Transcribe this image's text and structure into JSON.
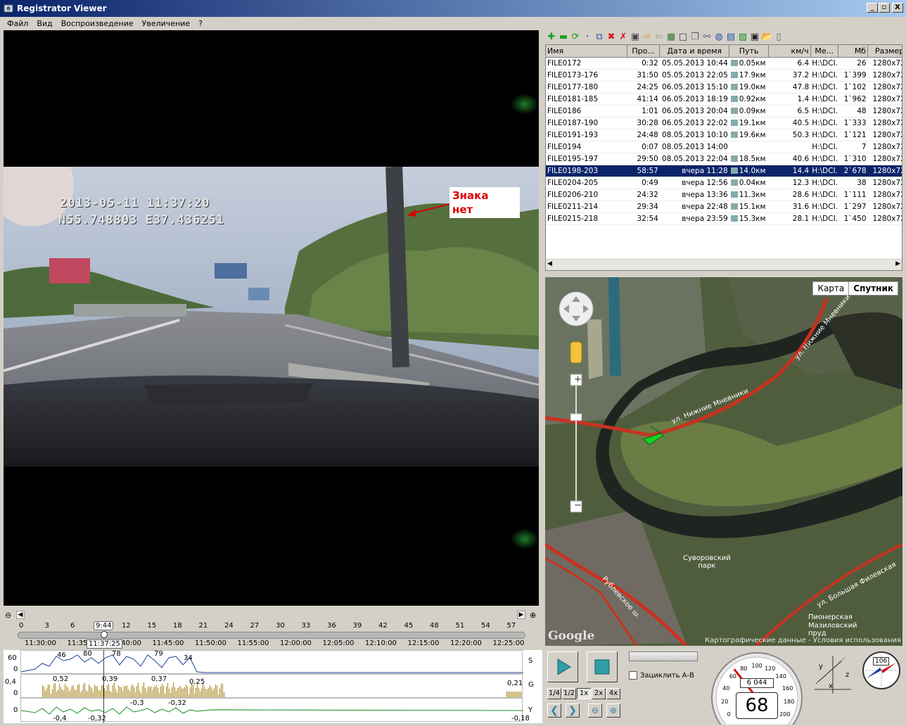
{
  "window": {
    "title": "Registrator Viewer",
    "minimize": "_",
    "restore": "▫",
    "close": "X"
  },
  "menu": [
    "Файл",
    "Вид",
    "Воспроизведение",
    "Увеличение",
    "?"
  ],
  "video": {
    "osd_datetime": "2013-05-11 11:37:20",
    "osd_coords": "N55.748803 E37.436251",
    "annotation": "Знака\nнет"
  },
  "filelist": {
    "columns": [
      "Имя",
      "Про...",
      "Дата и время",
      "Путь",
      "км/ч",
      "Ме...",
      "Мб",
      "Размер"
    ],
    "rows": [
      [
        "FILE0172",
        "0:32",
        "05.05.2013 10:44",
        "0.05км",
        "6.4",
        "H:\\DCI...",
        "26",
        "1280x720"
      ],
      [
        "FILE0173-176",
        "31:50",
        "05.05.2013 22:05",
        "17.9км",
        "37.2",
        "H:\\DCI...",
        "1`399",
        "1280x720"
      ],
      [
        "FILE0177-180",
        "24:25",
        "06.05.2013 15:10",
        "19.0км",
        "47.8",
        "H:\\DCI...",
        "1`102",
        "1280x720"
      ],
      [
        "FILE0181-185",
        "41:14",
        "06.05.2013 18:19",
        "0.92км",
        "1.4",
        "H:\\DCI...",
        "1`962",
        "1280x720"
      ],
      [
        "FILE0186",
        "1:01",
        "06.05.2013 20:04",
        "0.09км",
        "6.5",
        "H:\\DCI...",
        "48",
        "1280x720"
      ],
      [
        "FILE0187-190",
        "30:28",
        "06.05.2013 22:02",
        "19.1км",
        "40.5",
        "H:\\DCI...",
        "1`333",
        "1280x720"
      ],
      [
        "FILE0191-193",
        "24:48",
        "08.05.2013 10:10",
        "19.6км",
        "50.3",
        "H:\\DCI...",
        "1`121",
        "1280x720"
      ],
      [
        "FILE0194",
        "0:07",
        "08.05.2013 14:00",
        "",
        "",
        "H:\\DCI...",
        "7",
        "1280x720"
      ],
      [
        "FILE0195-197",
        "29:50",
        "08.05.2013 22:04",
        "18.5км",
        "40.6",
        "H:\\DCI...",
        "1`310",
        "1280x720"
      ],
      [
        "FILE0198-203",
        "58:57",
        "вчера 11:28",
        "14.0км",
        "14.4",
        "H:\\DCI...",
        "2`678",
        "1280x720"
      ],
      [
        "FILE0204-205",
        "0:49",
        "вчера 12:56",
        "0.04км",
        "12.3",
        "H:\\DCI...",
        "38",
        "1280x720"
      ],
      [
        "FILE0206-210",
        "24:32",
        "вчера 13:36",
        "11.3км",
        "28.6",
        "H:\\DCI...",
        "1`111",
        "1280x720"
      ],
      [
        "FILE0211-214",
        "29:34",
        "вчера 22:48",
        "15.1км",
        "31.6",
        "H:\\DCI...",
        "1`297",
        "1280x720"
      ],
      [
        "FILE0215-218",
        "32:54",
        "вчера 23:59",
        "15.3км",
        "28.1",
        "H:\\DCI...",
        "1`450",
        "1280x720"
      ]
    ],
    "selected_index": 9
  },
  "map": {
    "type_map": "Карта",
    "type_satellite": "Спутник",
    "active_type": "Спутник",
    "street1": "ул. Нижние Мневники",
    "street2": "ул. Нижние Мневники",
    "park": "Суворовский\nпарк",
    "station": "Пионерская",
    "pond": "Мазиловский\nпруд",
    "street3": "ул. Большая Филевская",
    "street4": "Рублевское ш.",
    "google": "Google",
    "credit": "Картографические данные - Условия использования"
  },
  "timeline": {
    "minutes": [
      "0",
      "3",
      "6",
      "9",
      "12",
      "15",
      "18",
      "21",
      "24",
      "27",
      "30",
      "33",
      "36",
      "39",
      "42",
      "45",
      "48",
      "51",
      "54",
      "57"
    ],
    "position_label": "9:44",
    "clock_ticks": [
      "11:30:00",
      "11:35",
      "11:40:00",
      "11:45:00",
      "11:50:00",
      "11:55:00",
      "12:00:00",
      "12:05:00",
      "12:10:00",
      "12:15:00",
      "12:20:00",
      "12:25:00"
    ],
    "clock_position": "11:37:25"
  },
  "graphs": {
    "speed": {
      "axis": "S",
      "ymax": "60",
      "ymin": "0",
      "labels": [
        "46",
        "80",
        "78",
        "79",
        "34"
      ]
    },
    "g": {
      "axis": "G",
      "ymax": "0,4",
      "ymin": "0",
      "labels": [
        "0,52",
        "0,39",
        "0,37",
        "0,25",
        "0,21"
      ]
    },
    "y": {
      "axis": "Y",
      "ymin": "0",
      "labels": [
        "-0,3",
        "-0,32",
        "-0,4",
        "-0,32",
        "-0,18"
      ]
    }
  },
  "controls": {
    "loop_label": "Зациклить А-В",
    "speeds": [
      "1/4",
      "1/2",
      "1x",
      "2x",
      "4x"
    ],
    "active_speed": "1x"
  },
  "speedometer": {
    "ticks": [
      "0",
      "20",
      "40",
      "60",
      "80",
      "100",
      "120",
      "140",
      "160",
      "180",
      "200"
    ],
    "odometer": "6 044",
    "speed": "68"
  },
  "compass": {
    "heading": "106"
  },
  "accel": {
    "x": "x",
    "y": "y",
    "z": "z"
  }
}
